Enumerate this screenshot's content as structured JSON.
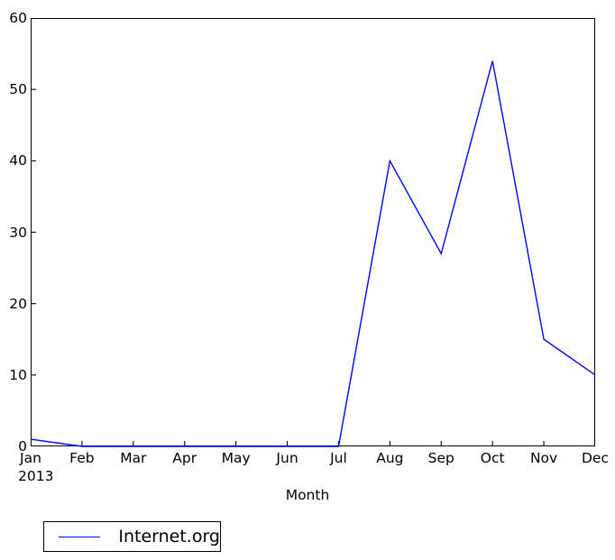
{
  "chart_data": {
    "type": "line",
    "title": "",
    "xlabel": "Month",
    "ylabel": "",
    "categories": [
      "Jan",
      "Feb",
      "Mar",
      "Apr",
      "May",
      "Jun",
      "Jul",
      "Aug",
      "Sep",
      "Oct",
      "Nov",
      "Dec"
    ],
    "x_sublabel": "2013",
    "series": [
      {
        "name": "Internet.org",
        "color": "#0000ff",
        "values": [
          1,
          0,
          0,
          0,
          0,
          0,
          0,
          40,
          27,
          54,
          15,
          10
        ]
      }
    ],
    "ylim": [
      0,
      60
    ],
    "yticks": [
      0,
      10,
      20,
      30,
      40,
      50,
      60
    ],
    "ytick_labels": [
      "0",
      "10",
      "20",
      "30",
      "40",
      "50",
      "60"
    ],
    "grid": false,
    "legend_position": "below-left",
    "line_color": "#0000ff",
    "axis_color": "#000000",
    "background": "#ffffff"
  },
  "legend": {
    "entries": [
      {
        "label": "Internet.org",
        "color": "#0000ff"
      }
    ]
  }
}
